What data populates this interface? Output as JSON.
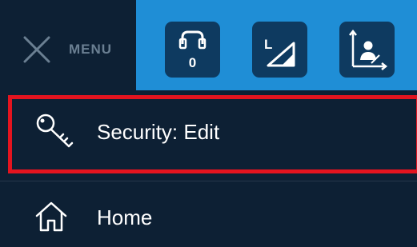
{
  "header": {
    "close_icon": "close-x-icon",
    "menu_label": "MENU",
    "toolbar": [
      {
        "icon": "gripper-icon",
        "badge": "0"
      },
      {
        "icon": "incline-icon",
        "letter": "L"
      },
      {
        "icon": "coordinate-frame-icon"
      }
    ]
  },
  "menu": {
    "items": [
      {
        "icon": "key-icon",
        "label": "Security: Edit",
        "highlighted": true
      },
      {
        "icon": "home-icon",
        "label": "Home"
      }
    ]
  },
  "colors": {
    "background": "#0d2034",
    "toolbar_blue": "#1f8ed6",
    "tool_button": "#0e3a60",
    "highlight": "#e3141f"
  }
}
